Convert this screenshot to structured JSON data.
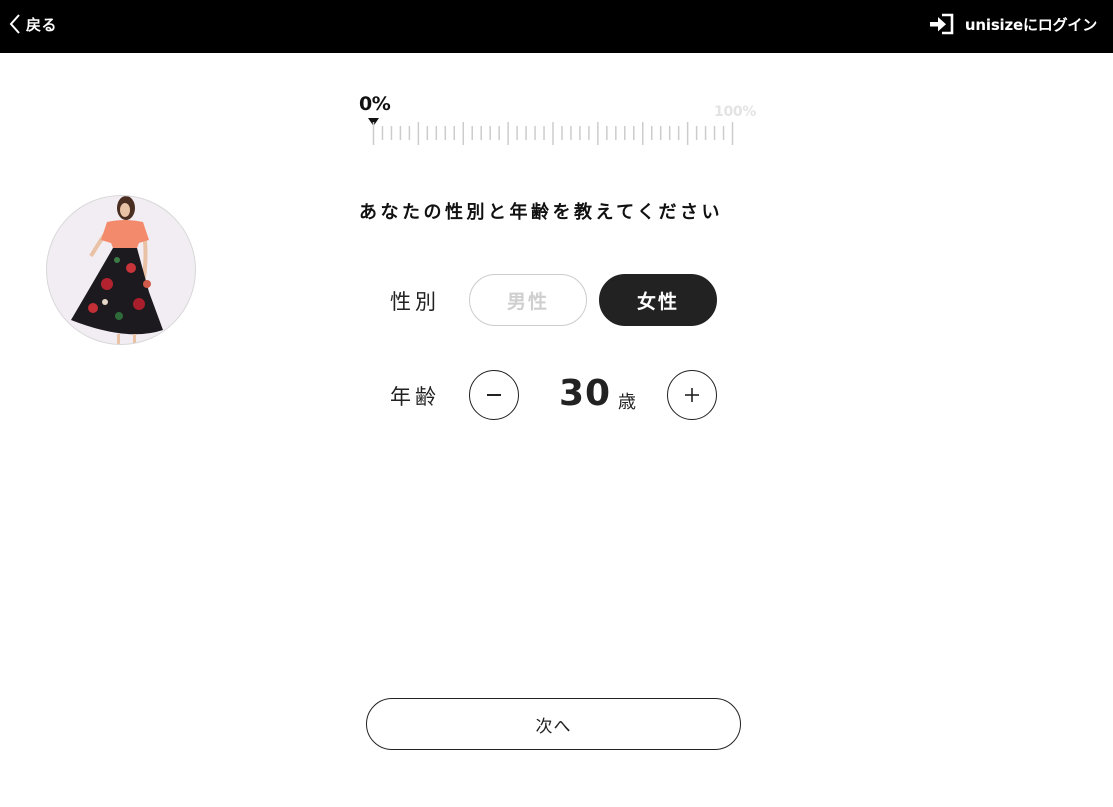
{
  "header": {
    "back_label": "戻る",
    "back_icon": "chevron-left-icon",
    "login_label": "unisizeにログイン",
    "login_icon": "sign-in-icon"
  },
  "product": {
    "image": "product-photo"
  },
  "progress": {
    "current_label": "0%",
    "max_label": "100%",
    "value": 0
  },
  "question": "あなたの性別と年齢を教えてください",
  "gender": {
    "label": "性別",
    "options": [
      {
        "label": "男性",
        "selected": false
      },
      {
        "label": "女性",
        "selected": true
      }
    ]
  },
  "age": {
    "label": "年齢",
    "value": "30",
    "unit": "歳",
    "minus_icon": "minus-icon",
    "plus_icon": "plus-icon"
  },
  "next_label": "次へ",
  "colors": {
    "header_bg": "#000000",
    "selected_bg": "#222222",
    "unselected_text": "#cfcfcf",
    "ruler": "#cccccc"
  }
}
